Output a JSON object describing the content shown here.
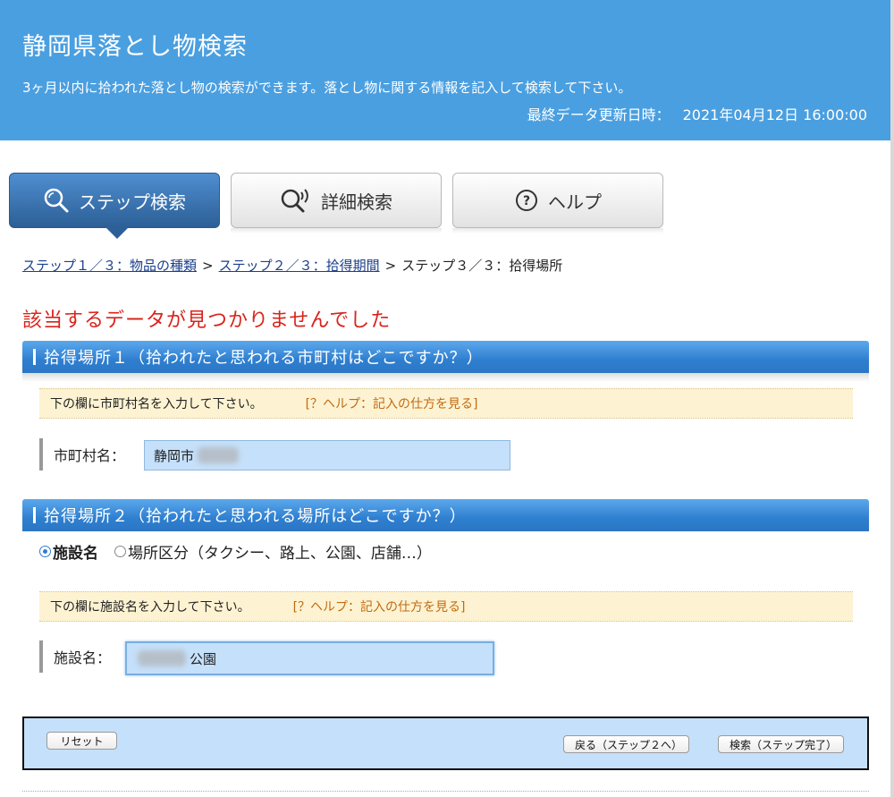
{
  "header": {
    "title": "静岡県落とし物検索",
    "subtitle": "3ヶ月以内に拾われた落とし物の検索ができます。落とし物に関する情報を記入して検索して下さい。",
    "updated_label": "最終データ更新日時：",
    "updated_value": "2021年04月12日 16:00:00",
    "color": "#4a9fe0"
  },
  "tabs": [
    {
      "label": "ステップ検索",
      "icon": "search-icon",
      "active": true
    },
    {
      "label": "詳細検索",
      "icon": "search-voice-icon",
      "active": false
    },
    {
      "label": "ヘルプ",
      "icon": "help-icon",
      "active": false
    }
  ],
  "breadcrumb": {
    "step1": "ステップ１／３：物品の種類",
    "step2": "ステップ２／３：拾得期間",
    "step3": "ステップ３／３：拾得場所",
    "separator": ">"
  },
  "error_message": "該当するデータが見つかりませんでした",
  "section1": {
    "title": "拾得場所１（拾われたと思われる市町村はどこですか？）",
    "hint": "下の欄に市町村名を入力して下さい。",
    "help_link": "[？ヘルプ：記入の仕方を見る]",
    "field_label": "市町村名：",
    "field_value": "静岡市"
  },
  "section2": {
    "title": "拾得場所２（拾われたと思われる場所はどこですか？）",
    "radio_facility": "施設名",
    "radio_category": "場所区分（タクシー、路上、公園、店舗…）",
    "hint": "下の欄に施設名を入力して下さい。",
    "help_link": "[？ヘルプ：記入の仕方を見る]",
    "field_label": "施設名：",
    "field_value": "公園"
  },
  "buttons": {
    "reset": "リセット",
    "back": "戻る（ステップ２へ）",
    "search": "検索（ステップ完了）"
  }
}
